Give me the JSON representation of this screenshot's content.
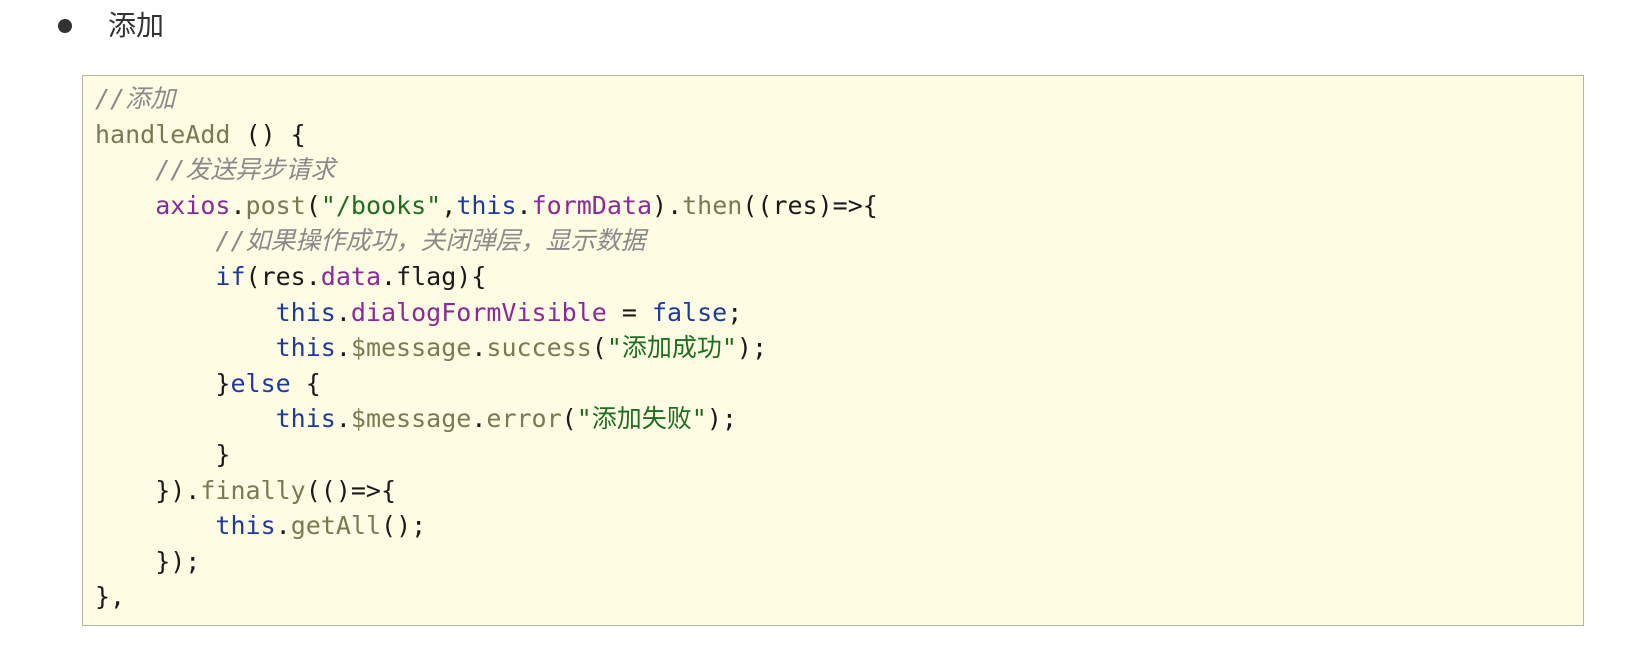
{
  "bullet": {
    "text": "添加"
  },
  "code_block": {
    "lines": [
      [
        {
          "t": "comment",
          "v": "//添加"
        }
      ],
      [
        {
          "t": "fn",
          "v": "handleAdd"
        },
        {
          "t": "plain",
          "v": " () {"
        }
      ],
      [
        {
          "t": "plain",
          "v": "    "
        },
        {
          "t": "comment",
          "v": "//发送异步请求"
        }
      ],
      [
        {
          "t": "plain",
          "v": "    "
        },
        {
          "t": "obj",
          "v": "axios"
        },
        {
          "t": "plain",
          "v": "."
        },
        {
          "t": "fn",
          "v": "post"
        },
        {
          "t": "plain",
          "v": "("
        },
        {
          "t": "str",
          "v": "\"/books\""
        },
        {
          "t": "plain",
          "v": ","
        },
        {
          "t": "kw",
          "v": "this"
        },
        {
          "t": "plain",
          "v": "."
        },
        {
          "t": "prop",
          "v": "formData"
        },
        {
          "t": "plain",
          "v": ")."
        },
        {
          "t": "fn",
          "v": "then"
        },
        {
          "t": "plain",
          "v": "((res)=>{"
        }
      ],
      [
        {
          "t": "plain",
          "v": "        "
        },
        {
          "t": "comment",
          "v": "//如果操作成功，关闭弹层，显示数据"
        }
      ],
      [
        {
          "t": "plain",
          "v": "        "
        },
        {
          "t": "kw",
          "v": "if"
        },
        {
          "t": "plain",
          "v": "(res."
        },
        {
          "t": "prop",
          "v": "data"
        },
        {
          "t": "plain",
          "v": ".flag){"
        }
      ],
      [
        {
          "t": "plain",
          "v": "            "
        },
        {
          "t": "kw",
          "v": "this"
        },
        {
          "t": "plain",
          "v": "."
        },
        {
          "t": "prop",
          "v": "dialogFormVisible"
        },
        {
          "t": "plain",
          "v": " = "
        },
        {
          "t": "kw",
          "v": "false"
        },
        {
          "t": "plain",
          "v": ";"
        }
      ],
      [
        {
          "t": "plain",
          "v": "            "
        },
        {
          "t": "kw",
          "v": "this"
        },
        {
          "t": "plain",
          "v": "."
        },
        {
          "t": "fn",
          "v": "$message"
        },
        {
          "t": "plain",
          "v": "."
        },
        {
          "t": "fn",
          "v": "success"
        },
        {
          "t": "plain",
          "v": "("
        },
        {
          "t": "str",
          "v": "\"添加成功\""
        },
        {
          "t": "plain",
          "v": ");"
        }
      ],
      [
        {
          "t": "plain",
          "v": "        }"
        },
        {
          "t": "kw",
          "v": "else"
        },
        {
          "t": "plain",
          "v": " {"
        }
      ],
      [
        {
          "t": "plain",
          "v": "            "
        },
        {
          "t": "kw",
          "v": "this"
        },
        {
          "t": "plain",
          "v": "."
        },
        {
          "t": "fn",
          "v": "$message"
        },
        {
          "t": "plain",
          "v": "."
        },
        {
          "t": "fn",
          "v": "error"
        },
        {
          "t": "plain",
          "v": "("
        },
        {
          "t": "str",
          "v": "\"添加失败\""
        },
        {
          "t": "plain",
          "v": ");"
        }
      ],
      [
        {
          "t": "plain",
          "v": "        }"
        }
      ],
      [
        {
          "t": "plain",
          "v": "    })."
        },
        {
          "t": "fn",
          "v": "finally"
        },
        {
          "t": "plain",
          "v": "(()=>{"
        }
      ],
      [
        {
          "t": "plain",
          "v": "        "
        },
        {
          "t": "kw",
          "v": "this"
        },
        {
          "t": "plain",
          "v": "."
        },
        {
          "t": "fn",
          "v": "getAll"
        },
        {
          "t": "plain",
          "v": "();"
        }
      ],
      [
        {
          "t": "plain",
          "v": "    });"
        }
      ],
      [
        {
          "t": "plain",
          "v": "},"
        }
      ]
    ]
  }
}
